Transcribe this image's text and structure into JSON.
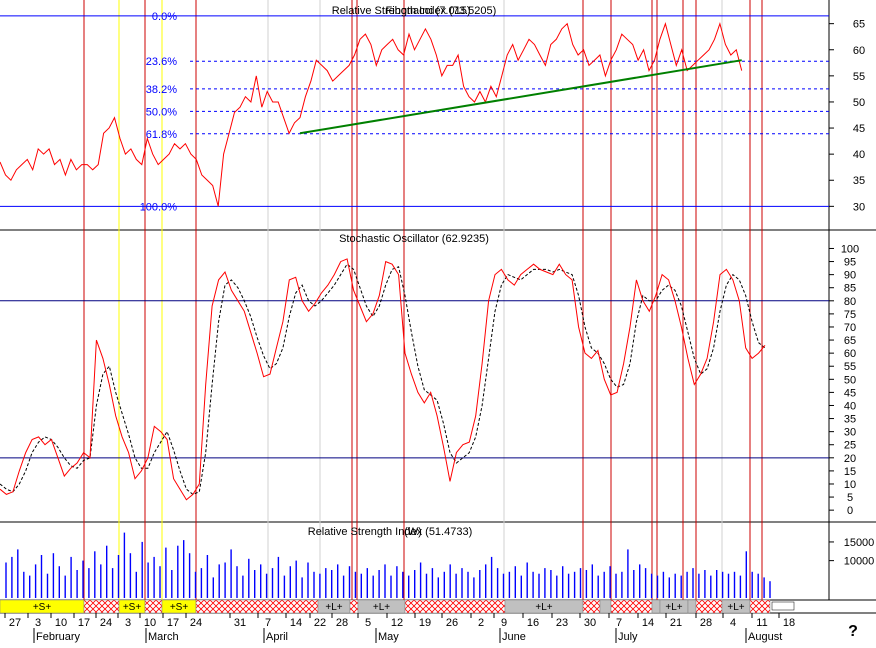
{
  "colors": {
    "price": "#ff0000",
    "fib": "#0000ff",
    "trend": "#008000",
    "vline_red": "#cc0000",
    "vline_yellow": "#ffff00",
    "hline": "#000080",
    "signal": "#000000",
    "volume": "#0000ff",
    "sig_yellow": "#ffff00",
    "sig_gray": "#c0c0c0",
    "sig_hatch": "#ff0000"
  },
  "chart_data": [
    {
      "type": "line",
      "title": "Relative Strength Index (73.5205)",
      "title_overlap": "Fibonacci (7.015)",
      "y_ticks": [
        "65",
        "60",
        "55",
        "50",
        "45",
        "40",
        "35",
        "30"
      ],
      "ylim": [
        27,
        68
      ],
      "fib_levels": [
        {
          "label": "0.0%",
          "value": 66.5
        },
        {
          "label": "23.6%",
          "value": 57.8
        },
        {
          "label": "38.2%",
          "value": 52.5
        },
        {
          "label": "50.0%",
          "value": 48.2
        },
        {
          "label": "61.8%",
          "value": 43.9
        },
        {
          "label": "100.0%",
          "value": 30.0
        }
      ],
      "series": [
        {
          "values": [
            38.5,
            36,
            35,
            37,
            38,
            39,
            37,
            41,
            40,
            41,
            38,
            39,
            36,
            39,
            37,
            38,
            38,
            37,
            38,
            44,
            45,
            47,
            43,
            40,
            41,
            39,
            38,
            43,
            40,
            38,
            39,
            40,
            42,
            41,
            42,
            40,
            39,
            36,
            35,
            34,
            30,
            40,
            44,
            48,
            49,
            51,
            50,
            55,
            49,
            52,
            50,
            50,
            47,
            44,
            46,
            47,
            51,
            54,
            58,
            57,
            56,
            54,
            55,
            56,
            57,
            59,
            62,
            63,
            61,
            57,
            60,
            61,
            62,
            60,
            59,
            63,
            60,
            62,
            64,
            62,
            59,
            55,
            57,
            57,
            59,
            53,
            51,
            50,
            52,
            50,
            53,
            51,
            55,
            59,
            61,
            58,
            60,
            62,
            61,
            59,
            57,
            61,
            62,
            64,
            65,
            61,
            59,
            60,
            57,
            58,
            59,
            55,
            58,
            60,
            63,
            62,
            61,
            58,
            60,
            56,
            58,
            62,
            65,
            61,
            57,
            60,
            56,
            57,
            58,
            59,
            60,
            62,
            65,
            61,
            59,
            60,
            56
          ]
        }
      ],
      "trendline": {
        "start": [
          55,
          44
        ],
        "end": [
          136,
          58
        ]
      }
    },
    {
      "type": "line",
      "title": "Stochastic Oscillator (62.9235)",
      "y_ticks": [
        "100",
        "95",
        "90",
        "85",
        "80",
        "75",
        "70",
        "65",
        "60",
        "55",
        "50",
        "45",
        "40",
        "35",
        "30",
        "25",
        "20",
        "15",
        "10",
        "5",
        "0"
      ],
      "ylim": [
        -3,
        104
      ],
      "h_levels": [
        80,
        20
      ],
      "series": [
        {
          "name": "K",
          "values": [
            8,
            6,
            7,
            15,
            22,
            27,
            28,
            25,
            27,
            20,
            13,
            16,
            18,
            22,
            20,
            65,
            58,
            48,
            36,
            28,
            22,
            12,
            15,
            20,
            32,
            30,
            27,
            12,
            8,
            4,
            6,
            10,
            48,
            78,
            88,
            91,
            84,
            80,
            76,
            68,
            60,
            51,
            52,
            62,
            72,
            88,
            89,
            80,
            76,
            79,
            83,
            86,
            90,
            95,
            96,
            84,
            78,
            72,
            75,
            82,
            95,
            94,
            90,
            60,
            52,
            45,
            41,
            45,
            36,
            24,
            11,
            22,
            25,
            26,
            36,
            56,
            80,
            90,
            92,
            88,
            86,
            90,
            92,
            94,
            92,
            91,
            90,
            94,
            90,
            88,
            70,
            60,
            58,
            61,
            50,
            44,
            45,
            56,
            70,
            88,
            80,
            76,
            82,
            90,
            88,
            80,
            70,
            58,
            48,
            52,
            58,
            72,
            90,
            92,
            88,
            80,
            62,
            58,
            60,
            63
          ]
        },
        {
          "name": "D",
          "values": [
            10,
            8,
            7,
            10,
            15,
            22,
            26,
            28,
            27,
            24,
            20,
            17,
            16,
            19,
            20,
            40,
            52,
            55,
            45,
            37,
            29,
            20,
            16,
            16,
            22,
            26,
            30,
            23,
            15,
            8,
            6,
            7,
            22,
            48,
            72,
            86,
            88,
            85,
            80,
            74,
            66,
            59,
            54,
            56,
            62,
            74,
            83,
            86,
            80,
            78,
            80,
            83,
            86,
            90,
            94,
            92,
            85,
            78,
            74,
            78,
            86,
            92,
            93,
            82,
            68,
            55,
            46,
            44,
            42,
            33,
            22,
            18,
            20,
            22,
            28,
            40,
            58,
            76,
            86,
            90,
            89,
            88,
            90,
            92,
            92,
            92,
            91,
            92,
            91,
            90,
            82,
            70,
            62,
            60,
            56,
            50,
            47,
            48,
            56,
            72,
            82,
            80,
            80,
            84,
            86,
            84,
            78,
            68,
            58,
            52,
            54,
            62,
            76,
            86,
            90,
            88,
            82,
            72,
            64,
            62
          ]
        }
      ]
    },
    {
      "type": "bar",
      "title": "Relative Strength Index (51.4733)",
      "title_overlap": "(W)",
      "y_ticks": [
        "15000",
        "10000"
      ],
      "ylim": [
        0,
        19000
      ],
      "series": [
        {
          "values": [
            9500,
            11000,
            13000,
            7000,
            6000,
            9000,
            11500,
            6500,
            12000,
            8500,
            6000,
            11000,
            7500,
            10000,
            8000,
            12500,
            9000,
            14000,
            8000,
            11500,
            17500,
            12000,
            7000,
            15000,
            9500,
            11000,
            8500,
            13500,
            7500,
            14000,
            15500,
            12000,
            7000,
            8000,
            11500,
            5500,
            9000,
            9500,
            13000,
            8500,
            6000,
            10500,
            7500,
            9000,
            6500,
            8000,
            11000,
            6000,
            8500,
            10000,
            5500,
            9500,
            7000,
            6500,
            8000,
            7500,
            9000,
            6000,
            8500,
            7000,
            6500,
            8000,
            6000,
            7500,
            9000,
            6000,
            8500,
            7000,
            6000,
            7500,
            9500,
            6500,
            8000,
            5500,
            7000,
            9000,
            6500,
            8000,
            7000,
            5500,
            7500,
            9000,
            11000,
            8000,
            6500,
            7000,
            8500,
            6000,
            9500,
            7000,
            6500,
            8000,
            7500,
            6000,
            8500,
            6500,
            7000,
            8000,
            7500,
            9000,
            6000,
            7000,
            8500,
            6500,
            7000,
            13000,
            7500,
            9000,
            8000,
            6500,
            6000,
            7000,
            5500,
            6500,
            6000,
            7000,
            8000,
            6500,
            7500,
            6000,
            7500,
            7000,
            6500,
            7000,
            6000,
            12500,
            7000,
            6500,
            5500,
            4500
          ]
        }
      ]
    }
  ],
  "signal_bar": [
    {
      "kind": "yellow",
      "label": "+S+",
      "from": 0,
      "to": 84
    },
    {
      "kind": "hatch",
      "label": "",
      "from": 84,
      "to": 119
    },
    {
      "kind": "yellow",
      "label": "+S+",
      "from": 119,
      "to": 145
    },
    {
      "kind": "hatch",
      "label": "",
      "from": 145,
      "to": 162
    },
    {
      "kind": "yellow",
      "label": "+S+",
      "from": 162,
      "to": 196
    },
    {
      "kind": "hatch",
      "label": "",
      "from": 196,
      "to": 318
    },
    {
      "kind": "gray",
      "label": "+L+",
      "from": 318,
      "to": 350
    },
    {
      "kind": "hatch",
      "label": "",
      "from": 350,
      "to": 358
    },
    {
      "kind": "gray",
      "label": "+L+",
      "from": 358,
      "to": 405
    },
    {
      "kind": "hatch",
      "label": "",
      "from": 405,
      "to": 505
    },
    {
      "kind": "gray",
      "label": "+L+",
      "from": 505,
      "to": 583
    },
    {
      "kind": "hatch",
      "label": "",
      "from": 583,
      "to": 600
    },
    {
      "kind": "gray",
      "label": "",
      "from": 600,
      "to": 611
    },
    {
      "kind": "hatch",
      "label": "",
      "from": 611,
      "to": 652
    },
    {
      "kind": "gray",
      "label": "",
      "from": 652,
      "to": 660
    },
    {
      "kind": "gray",
      "label": "+L+",
      "from": 660,
      "to": 688
    },
    {
      "kind": "gray",
      "label": "",
      "from": 688,
      "to": 696
    },
    {
      "kind": "hatch",
      "label": "",
      "from": 696,
      "to": 722
    },
    {
      "kind": "gray",
      "label": "+L+",
      "from": 722,
      "to": 750
    },
    {
      "kind": "hatch",
      "label": "",
      "from": 750,
      "to": 770
    }
  ],
  "x_axis": {
    "days": [
      "27",
      "3",
      "10",
      "17",
      "24",
      "3",
      "10",
      "17",
      "24",
      "31",
      "7",
      "14",
      "22",
      "28",
      "5",
      "12",
      "19",
      "26",
      "2",
      "9",
      "16",
      "23",
      "30",
      "7",
      "14",
      "21",
      "28",
      "4",
      "11",
      "18"
    ],
    "months": [
      "February",
      "March",
      "April",
      "May",
      "June",
      "July",
      "August"
    ],
    "help_icon": "?"
  }
}
